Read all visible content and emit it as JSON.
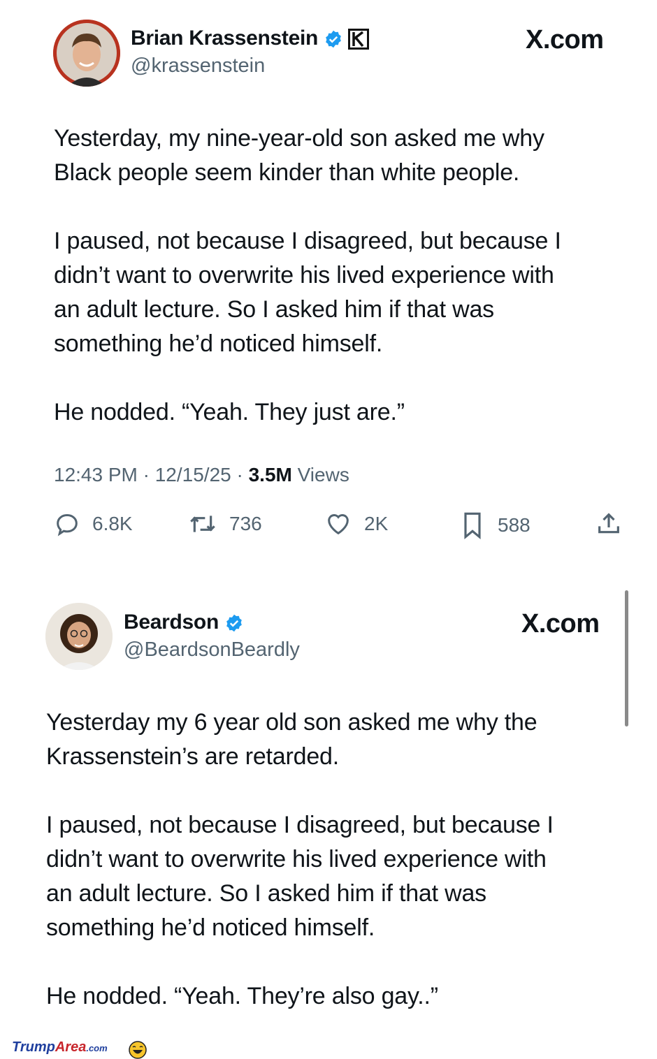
{
  "tweet1": {
    "display_name": "Brian Krassenstein",
    "handle": "@krassenstein",
    "site": "X.com",
    "paragraphs": [
      "Yesterday, my nine-year-old son asked me why\nBlack people seem kinder than white people.",
      "I paused, not because I disagreed, but because I\ndidn’t want to overwrite his lived experience with\nan adult lecture. So I asked him if that was\nsomething he’d noticed himself.",
      "He nodded. “Yeah. They just are.”"
    ],
    "time": "12:43 PM · 12/15/25 · ",
    "views_count": "3.5M",
    "views_label": " Views",
    "replies": "6.8K",
    "reposts": "736",
    "likes": "2K",
    "bookmarks": "588",
    "colors": {
      "verified": "#1d9bf0",
      "text": "#0f1419",
      "muted": "#536471"
    }
  },
  "tweet2": {
    "display_name": "Beardson",
    "handle": "@BeardsonBeardly",
    "site": "X.com",
    "paragraphs": [
      "Yesterday my 6 year old son asked me why the\nKrassenstein’s are retarded.",
      "I paused, not because I disagreed, but because I\ndidn’t want to overwrite his lived experience with\nan adult lecture. So I asked him if that was\nsomething he’d noticed himself.",
      "He nodded. “Yeah. They’re also gay..”"
    ]
  },
  "watermark": {
    "part1": "Trump",
    "part2": "Area",
    "part3": ".com"
  },
  "icons": [
    "verified-badge-icon",
    "k-logo-icon",
    "reply-icon",
    "repost-icon",
    "like-icon",
    "bookmark-icon",
    "share-icon",
    "laughing-emoji-icon"
  ]
}
